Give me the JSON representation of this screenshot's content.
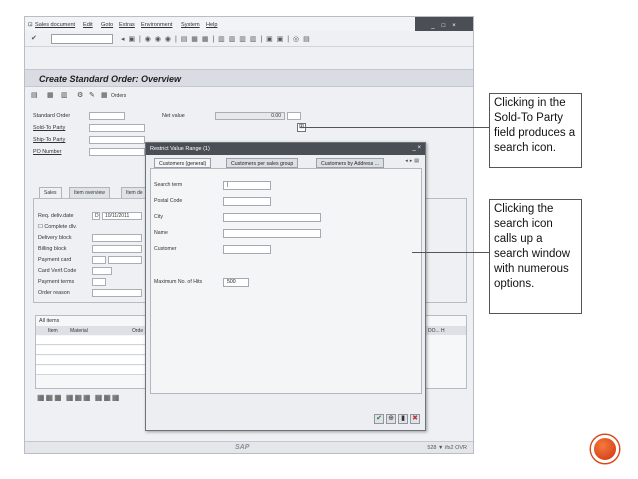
{
  "menubar": {
    "items": [
      "Sales document",
      "Edit",
      "Goto",
      "Extras",
      "Environment",
      "System",
      "Help"
    ]
  },
  "toolbar": {
    "command_value": ""
  },
  "screen_title": "Create Standard Order: Overview",
  "app_toolbar": {
    "orders_label": "Orders"
  },
  "header_fields": {
    "standard_order_label": "Standard Order",
    "net_value_label": "Net value",
    "net_value": "0.00",
    "sold_to_label": "Sold-To Party",
    "ship_to_label": "Ship-To Party",
    "po_number_label": "PO Number"
  },
  "main_tabs": [
    "Sales",
    "Item overview",
    "Item de"
  ],
  "sales_fields": {
    "req_deliv_date_label": "Req. deliv.date",
    "req_deliv_date_type": "D",
    "req_deliv_date": "10/11/2011",
    "complete_dlv_label": "Complete dlv.",
    "delivery_block_label": "Delivery block",
    "billing_block_label": "Billing block",
    "payment_card_label": "Payment card",
    "card_verif_label": "Card Verif.Code",
    "payment_terms_label": "Payment terms",
    "order_reason_label": "Order reason"
  },
  "items_grid": {
    "title": "All items",
    "col_item": "Item",
    "col_material": "Material",
    "col_order": "Orde",
    "col_right": "DO... H"
  },
  "statusbar": {
    "system": "528 ▼  ifs2  OVR"
  },
  "dialog": {
    "title": "Restrict Value Range (1)",
    "tabs": [
      "Customers (general)",
      "Customers per sales group",
      "Customers by Address ..."
    ],
    "fields": {
      "search_term_label": "Search term",
      "postal_code_label": "Postal Code",
      "city_label": "City",
      "name_label": "Name",
      "customer_label": "Customer",
      "max_hits_label": "Maximum No. of Hits",
      "max_hits_value": "500"
    }
  },
  "callouts": [
    "Clicking in the Sold-To Party field produces a search icon.",
    "Clicking the search icon calls up a search window with numerous options."
  ],
  "colors": {
    "accent_circle": "#e05a2b",
    "dialog_title": "#4a4f56"
  }
}
